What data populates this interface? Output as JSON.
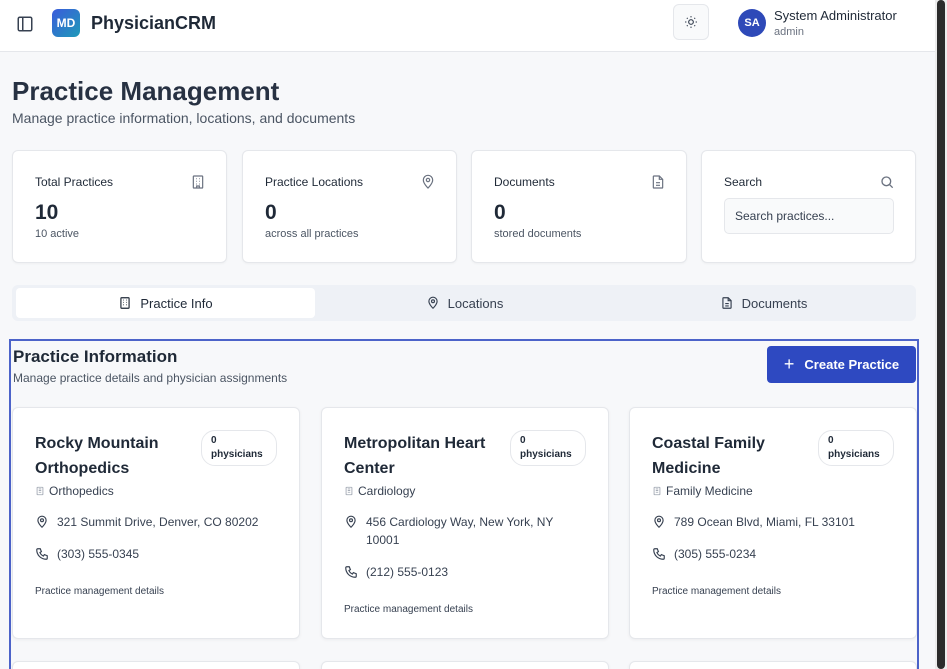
{
  "header": {
    "logo_text": "MD",
    "app_title": "PhysicianCRM",
    "user": {
      "initials": "SA",
      "name": "System Administrator",
      "role": "admin"
    }
  },
  "page": {
    "title": "Practice Management",
    "subtitle": "Manage practice information, locations, and documents"
  },
  "stats": [
    {
      "label": "Total Practices",
      "value": "10",
      "sub": "10 active",
      "icon": "building-icon"
    },
    {
      "label": "Practice Locations",
      "value": "0",
      "sub": "across all practices",
      "icon": "map-pin-icon"
    },
    {
      "label": "Documents",
      "value": "0",
      "sub": "stored documents",
      "icon": "file-icon"
    }
  ],
  "search": {
    "label": "Search",
    "placeholder": "Search practices..."
  },
  "tabs": [
    {
      "label": "Practice Info",
      "icon": "building-icon",
      "active": true
    },
    {
      "label": "Locations",
      "icon": "map-pin-icon",
      "active": false
    },
    {
      "label": "Documents",
      "icon": "file-icon",
      "active": false
    }
  ],
  "section": {
    "title": "Practice Information",
    "subtitle": "Manage practice details and physician assignments",
    "create_label": "Create Practice"
  },
  "practices": [
    {
      "name": "Rocky Mountain Orthopedics",
      "badge": "0 physicians",
      "specialty": "Orthopedics",
      "address": "321 Summit Drive, Denver, CO 80202",
      "phone": "(303) 555-0345",
      "details": "Practice management details"
    },
    {
      "name": "Metropolitan Heart Center",
      "badge": "0 physicians",
      "specialty": "Cardiology",
      "address": "456 Cardiology Way, New York, NY 10001",
      "phone": "(212) 555-0123",
      "details": "Practice management details"
    },
    {
      "name": "Coastal Family Medicine",
      "badge": "0 physicians",
      "specialty": "Family Medicine",
      "address": "789 Ocean Blvd, Miami, FL 33101",
      "phone": "(305) 555-0234",
      "details": "Practice management details"
    }
  ],
  "colors": {
    "accent": "#2e49c1",
    "avatar": "#2e49b8",
    "section_border": "#4c63c9"
  }
}
